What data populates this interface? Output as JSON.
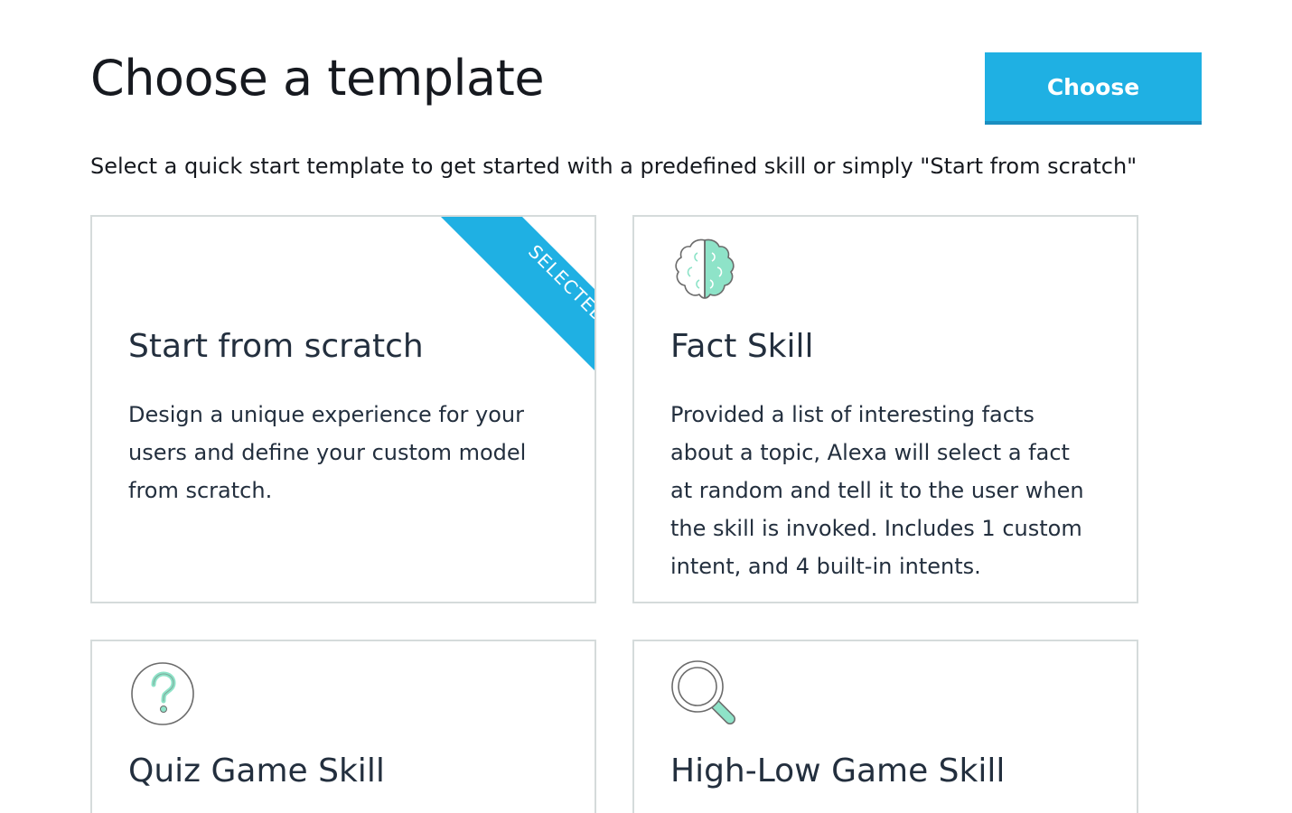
{
  "header": {
    "title": "Choose a template",
    "choose_button_label": "Choose"
  },
  "subtitle": "Select a quick start template to get started with a predefined skill or simply \"Start from scratch\"",
  "colors": {
    "accent": "#1fb0e3",
    "icon_green": "#8ee3c8",
    "card_border": "#d5dbdb"
  },
  "templates": [
    {
      "title": "Start from scratch",
      "description": "Design a unique experience for your users and define your custom model from scratch.",
      "selected": true,
      "badge": "SELECTED",
      "icon": "none"
    },
    {
      "title": "Fact Skill",
      "description": "Provided a list of interesting facts about a topic, Alexa will select a fact at random and tell it to the user when the skill is invoked. Includes 1 custom intent, and 4 built-in intents.",
      "selected": false,
      "icon": "brain-icon"
    },
    {
      "title": "Quiz Game Skill",
      "description": "",
      "selected": false,
      "icon": "question-mark-icon"
    },
    {
      "title": "High-Low Game Skill",
      "description": "",
      "selected": false,
      "icon": "magnifying-glass-icon"
    }
  ]
}
